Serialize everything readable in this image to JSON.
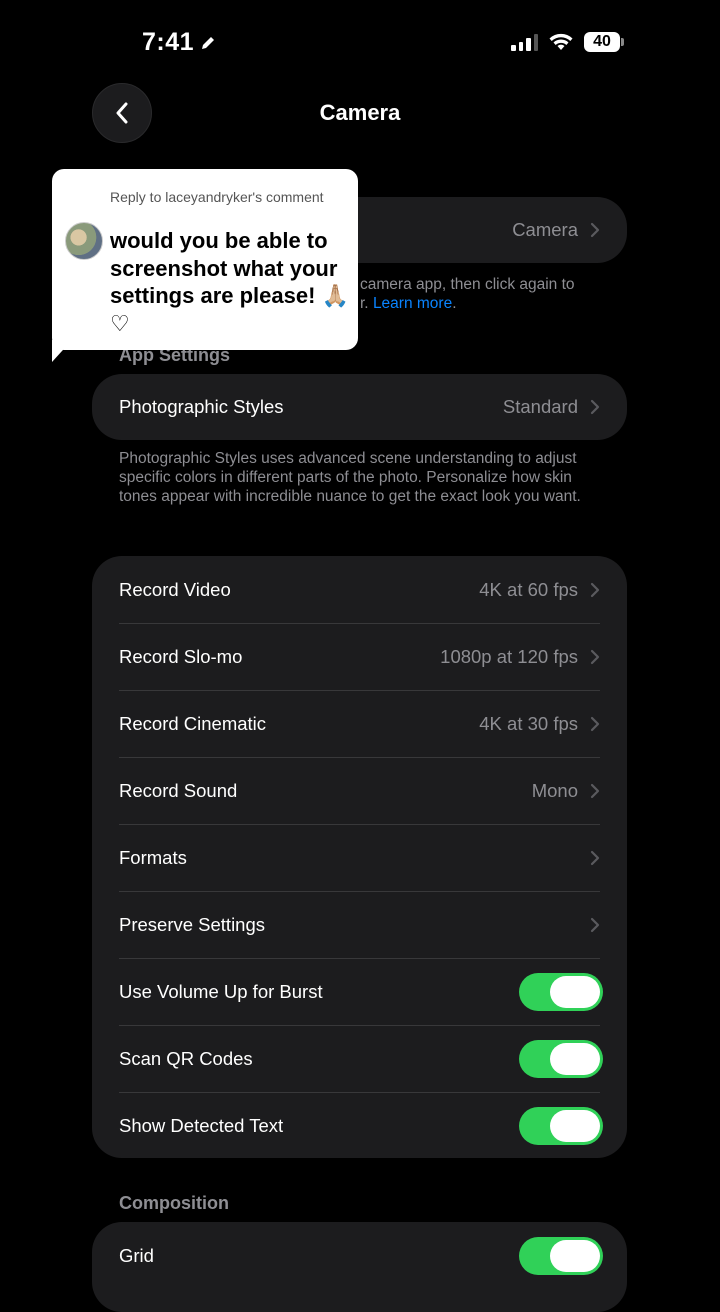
{
  "status_bar": {
    "time": "7:41",
    "battery": "40"
  },
  "header": {
    "title": "Camera"
  },
  "reply_bubble": {
    "reply_to": "Reply to laceyandryker's comment",
    "message": "would you be able to screenshot what your settings are please! 🙏🏼 ♡"
  },
  "top_group": {
    "value": "Camera"
  },
  "top_footer": {
    "text_before_link": "camera app, then click again to",
    "text_line2": "r.",
    "link": "Learn more",
    "text_after_link": "."
  },
  "app_settings": {
    "header": "App Settings",
    "photographic_styles": {
      "label": "Photographic Styles",
      "value": "Standard"
    },
    "footer": "Photographic Styles uses advanced scene understanding to adjust specific colors in different parts of the photo. Personalize how skin tones appear with incredible nuance to get the exact look you want."
  },
  "camera_settings": {
    "rows": [
      {
        "label": "Record Video",
        "value": "4K at 60 fps"
      },
      {
        "label": "Record Slo-mo",
        "value": "1080p at 120 fps"
      },
      {
        "label": "Record Cinematic",
        "value": "4K at 30 fps"
      },
      {
        "label": "Record Sound",
        "value": "Mono"
      },
      {
        "label": "Formats",
        "value": ""
      },
      {
        "label": "Preserve Settings",
        "value": ""
      },
      {
        "label": "Use Volume Up for Burst",
        "toggle": true
      },
      {
        "label": "Scan QR Codes",
        "toggle": true
      },
      {
        "label": "Show Detected Text",
        "toggle": true
      }
    ]
  },
  "composition": {
    "header": "Composition",
    "rows": [
      {
        "label": "Grid",
        "toggle": true
      }
    ]
  },
  "colors": {
    "toggle_on": "#30d158",
    "link": "#0a84ff",
    "cell_bg": "#1c1c1e"
  }
}
